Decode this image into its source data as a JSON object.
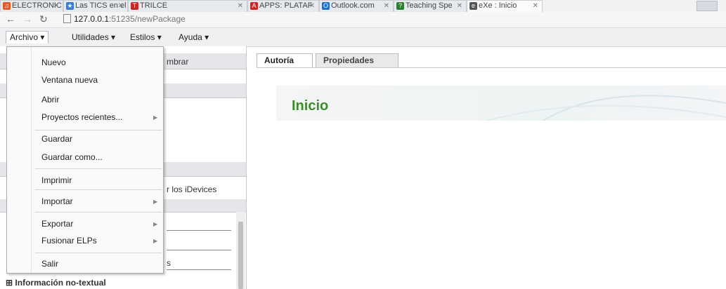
{
  "browser": {
    "tabs": [
      {
        "title": "ELECTRONIC",
        "icon": "headphones-icon",
        "color": "#e05a2b"
      },
      {
        "title": "Las TICS en el",
        "icon": "tics-icon",
        "color": "#3b7ecf"
      },
      {
        "title": "TRILCE",
        "icon": "trilce-icon",
        "color": "#c62828"
      },
      {
        "title": "APPS: PLATAF",
        "icon": "apps-icon",
        "color": "#c62828"
      },
      {
        "title": "Outlook.com",
        "icon": "outlook-icon",
        "color": "#1e6fcf"
      },
      {
        "title": "Teaching Spe",
        "icon": "teaching-icon",
        "color": "#2e7d32"
      },
      {
        "title": "eXe : Inicio",
        "icon": "exe-icon",
        "color": "#555555"
      }
    ],
    "url_host": "127.0.0.1",
    "url_path": ":51235/newPackage"
  },
  "menubar": {
    "archivo": "Archivo",
    "utilidades": "Utilidades",
    "estilos": "Estilos",
    "ayuda": "Ayuda"
  },
  "archivo_menu": [
    {
      "label": "Nuevo",
      "submenu": false
    },
    {
      "label": "Ventana nueva",
      "submenu": false
    },
    {
      "label": "Abrir",
      "submenu": false
    },
    {
      "label": "Proyectos recientes...",
      "submenu": true
    },
    {
      "label": "Guardar",
      "submenu": false
    },
    {
      "label": "Guardar como...",
      "submenu": false
    },
    {
      "label": "Imprimir",
      "submenu": false
    },
    {
      "label": "Importar",
      "submenu": true
    },
    {
      "label": "Exportar",
      "submenu": true
    },
    {
      "label": "Fusionar ELPs",
      "submenu": true
    },
    {
      "label": "Salir",
      "submenu": false
    }
  ],
  "left_panel": {
    "rename_partial": "mbrar",
    "idevices_partial": "r los iDevices",
    "s_partial": "s",
    "info_node": "Información no-textual"
  },
  "right_tabs": [
    "Autoría",
    "Propiedades"
  ],
  "page_title": "Inicio",
  "colors": {
    "title_green": "#3c8c2c"
  }
}
